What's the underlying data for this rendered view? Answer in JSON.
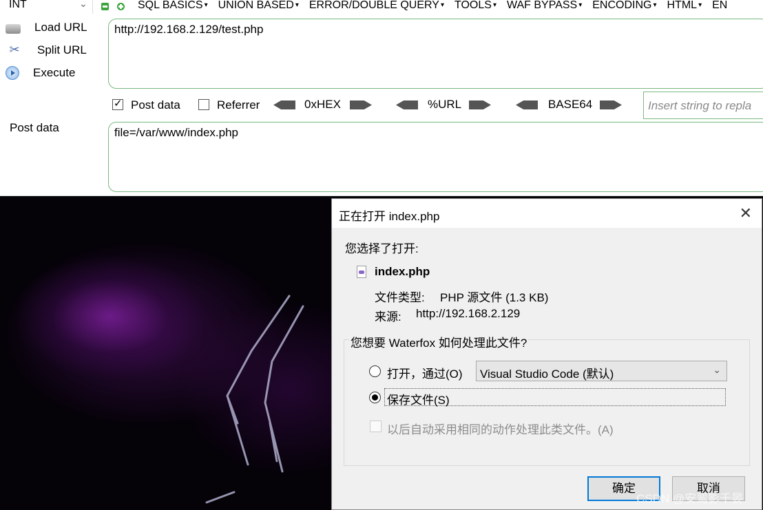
{
  "menubar": {
    "select_value": "INT",
    "items": [
      "SQL BASICS",
      "UNION BASED",
      "ERROR/DOUBLE QUERY",
      "TOOLS",
      "WAF BYPASS",
      "ENCODING",
      "HTML",
      "EN"
    ]
  },
  "sidebar": {
    "load_url": "Load URL",
    "split_url": "Split URL",
    "execute": "Execute"
  },
  "url_value": "http://192.168.2.129/test.php",
  "options": {
    "post_data_label": "Post data",
    "post_data_checked": true,
    "referrer_label": "Referrer",
    "referrer_checked": false,
    "hex": "0xHEX",
    "url": "%URL",
    "base64": "BASE64",
    "replace_placeholder": "Insert string to repla"
  },
  "post_label": "Post data",
  "post_value": "file=/var/www/index.php",
  "dialog": {
    "title": "正在打开 index.php",
    "you_chose": "您选择了打开:",
    "filename": "index.php",
    "file_type_label": "文件类型:",
    "file_type_value": "PHP 源文件 (1.3 KB)",
    "source_label": "来源:",
    "source_value": "http://192.168.2.129",
    "question": "您想要 Waterfox 如何处理此文件?",
    "open_with": "打开，通过(O)",
    "app": "Visual Studio Code (默认)",
    "save_file": "保存文件(S)",
    "remember": "以后自动采用相同的动作处理此类文件。(A)",
    "ok": "确定",
    "cancel": "取消"
  },
  "watermark": "CSDN @安鸾影千晏",
  "colors": {
    "field_border": "#78b87e",
    "accent": "#0078d7",
    "background": "#050208"
  }
}
